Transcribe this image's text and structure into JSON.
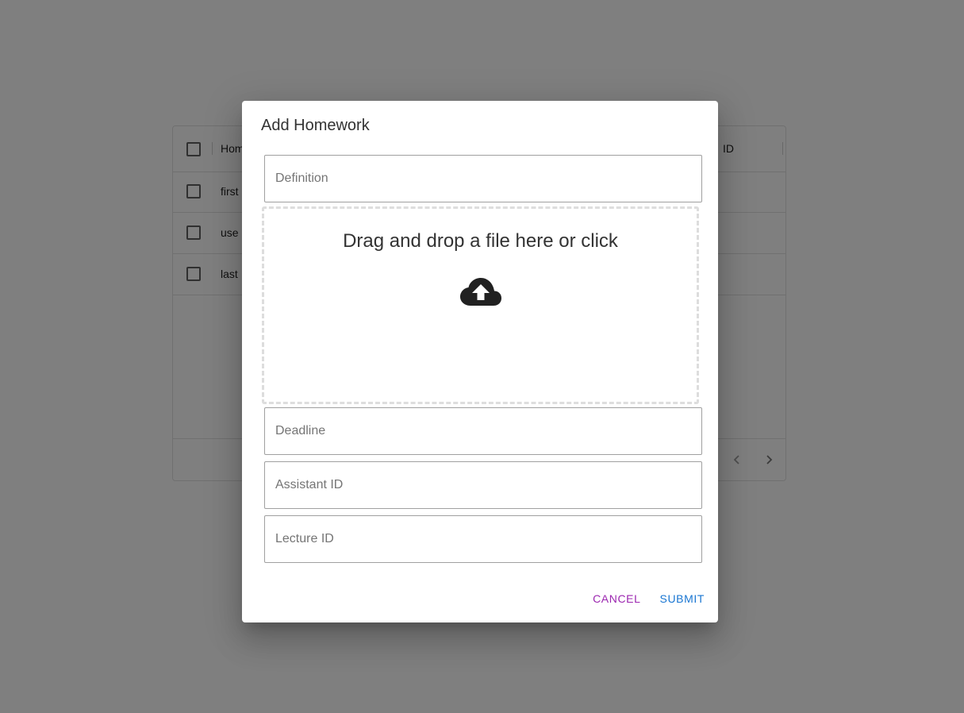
{
  "grid": {
    "header": {
      "first_col": "Hom",
      "right_col": "ID"
    },
    "rows": [
      {
        "text": "first"
      },
      {
        "text": "use"
      },
      {
        "text": "last"
      }
    ],
    "pager": {
      "prev_icon": "chevron-left-icon",
      "next_icon": "chevron-right-icon"
    }
  },
  "dialog": {
    "title": "Add Homework",
    "definition_placeholder": "Definition",
    "dropzone_text": "Drag and drop a file here or click",
    "dropzone_icon": "cloud-upload-icon",
    "deadline_placeholder": "Deadline",
    "assistant_placeholder": "Assistant ID",
    "lecture_placeholder": "Lecture ID",
    "cancel_label": "CANCEL",
    "submit_label": "SUBMIT"
  },
  "colors": {
    "cancel": "#9c27b0",
    "submit": "#1976d2",
    "backdrop": "rgba(0,0,0,0.5)"
  }
}
